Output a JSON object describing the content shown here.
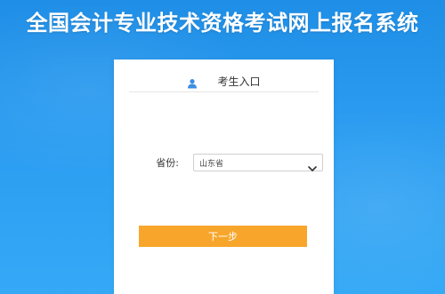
{
  "header": {
    "title": "全国会计专业技术资格考试网上报名系统"
  },
  "login_card": {
    "entry_tab": {
      "icon": "user-icon",
      "label": "考生入口"
    },
    "province_field": {
      "label": "省份:",
      "selected_value": "山东省",
      "icon": "chevron-down-icon"
    },
    "next_button_label": "下一步"
  },
  "colors": {
    "background": "#2a9bf0",
    "card": "#ffffff",
    "button": "#f7a62b",
    "icon": "#3a8ee6"
  }
}
